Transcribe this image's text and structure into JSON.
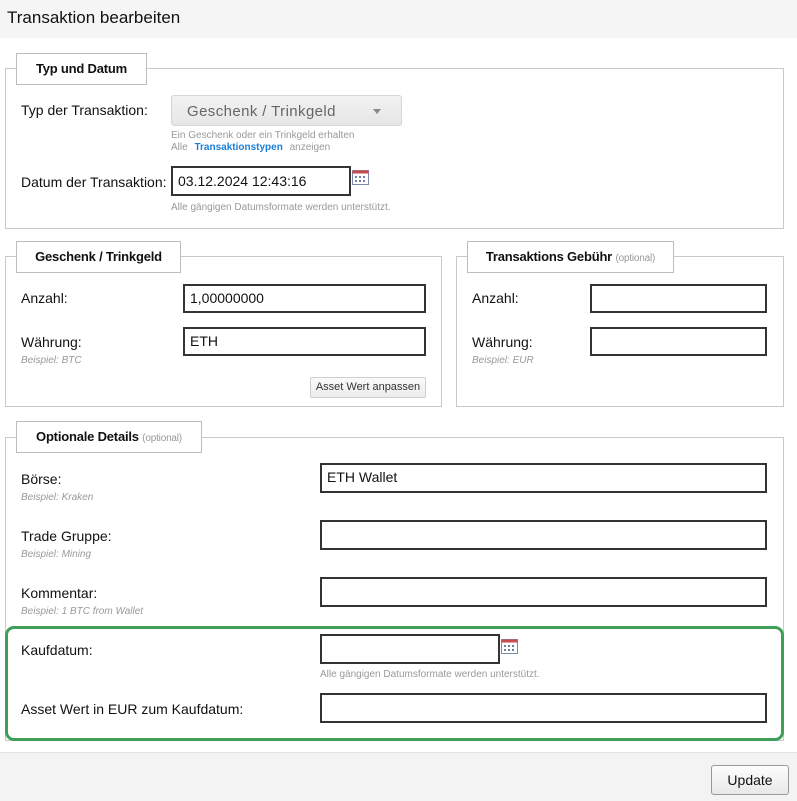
{
  "window": {
    "title": "Transaktion bearbeiten"
  },
  "typ_und_datum": {
    "legend": "Typ und Datum",
    "typ_label": "Typ der Transaktion:",
    "typ_value": "Geschenk / Trinkgeld",
    "typ_hint": "Ein Geschenk oder ein Trinkgeld erhalten",
    "typ_hint2_prefix": "Alle",
    "typ_hint2_link": "Transaktionstypen",
    "typ_hint2_suffix": "anzeigen",
    "datum_label": "Datum der Transaktion:",
    "datum_value": "03.12.2024 12:43:16",
    "datum_hint": "Alle gängigen Datumsformate werden unterstützt."
  },
  "geschenk": {
    "legend": "Geschenk / Trinkgeld",
    "anzahl_label": "Anzahl:",
    "anzahl_value": "1,00000000",
    "waehrung_label": "Währung:",
    "waehrung_value": "ETH",
    "waehrung_hint": "Beispiel: BTC",
    "asset_button": "Asset Wert anpassen"
  },
  "gebuehr": {
    "legend": "Transaktions Gebühr",
    "legend_optional": "(optional)",
    "anzahl_label": "Anzahl:",
    "anzahl_value": "",
    "waehrung_label": "Währung:",
    "waehrung_value": "",
    "waehrung_hint": "Beispiel: EUR"
  },
  "optionale_details": {
    "legend": "Optionale Details",
    "legend_optional": "(optional)",
    "boerse_label": "Börse:",
    "boerse_value": "ETH Wallet",
    "boerse_hint": "Beispiel: Kraken",
    "trade_gruppe_label": "Trade Gruppe:",
    "trade_gruppe_value": "",
    "trade_gruppe_hint": "Beispiel: Mining",
    "kommentar_label": "Kommentar:",
    "kommentar_value": "",
    "kommentar_hint": "Beispiel: 1 BTC from Wallet",
    "kaufdatum_label": "Kaufdatum:",
    "kaufdatum_value": "",
    "kaufdatum_hint": "Alle gängigen Datumsformate werden unterstützt.",
    "asset_wert_label": "Asset Wert in EUR zum Kaufdatum:",
    "asset_wert_value": ""
  },
  "footer": {
    "update_button": "Update"
  },
  "colors": {
    "highlight": "#3f9e58",
    "link": "#1b7fd6"
  }
}
